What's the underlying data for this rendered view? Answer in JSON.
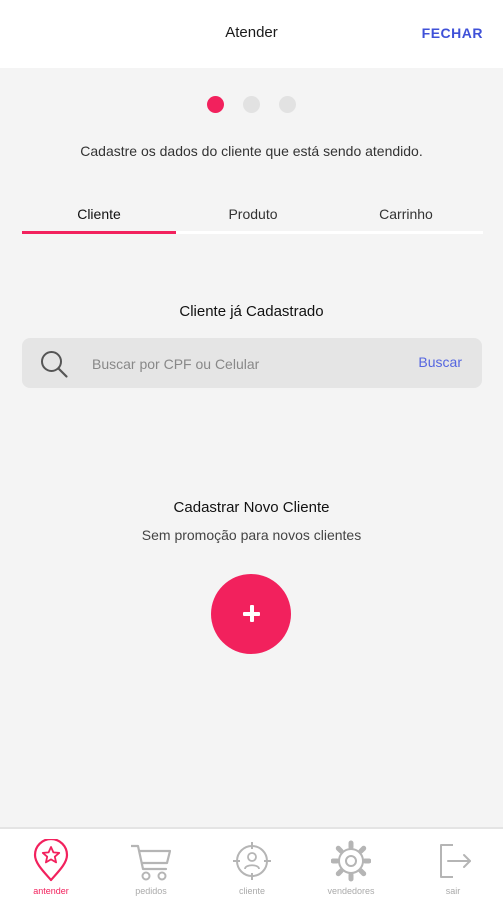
{
  "header": {
    "title": "Atender",
    "close_label": "FECHAR"
  },
  "steps": {
    "total": 3,
    "active": 1
  },
  "subtitle": "Cadastre os dados do cliente que está sendo atendido.",
  "tabs": [
    {
      "label": "Cliente",
      "active": true
    },
    {
      "label": "Produto",
      "active": false
    },
    {
      "label": "Carrinho",
      "active": false
    }
  ],
  "existing_client": {
    "title": "Cliente já Cadastrado",
    "search_placeholder": "Buscar por CPF ou Celular",
    "search_value": "",
    "search_button": "Buscar"
  },
  "new_client": {
    "title": "Cadastrar Novo Cliente",
    "note": "Sem promoção para novos clientes"
  },
  "bottom_nav": [
    {
      "label": "antender",
      "icon": "star-pin-icon",
      "active": true
    },
    {
      "label": "pedidos",
      "icon": "cart-icon",
      "active": false
    },
    {
      "label": "cliente",
      "icon": "person-target-icon",
      "active": false
    },
    {
      "label": "vendedores",
      "icon": "gear-icon",
      "active": false
    },
    {
      "label": "sair",
      "icon": "exit-icon",
      "active": false
    }
  ],
  "colors": {
    "accent": "#f2215d",
    "link": "#3f51d8",
    "background": "#f4f4f4"
  }
}
